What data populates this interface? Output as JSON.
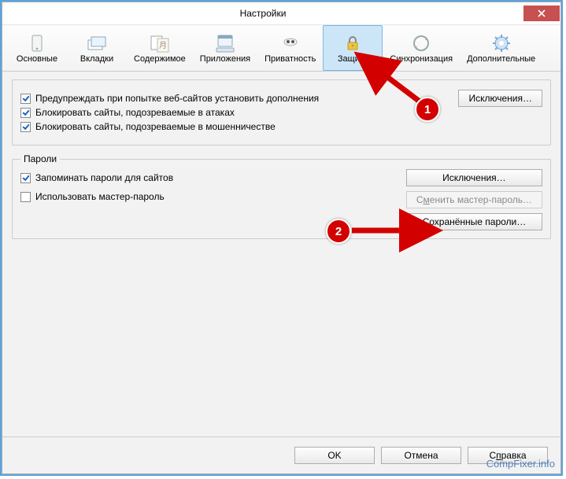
{
  "window": {
    "title": "Настройки"
  },
  "tabs": [
    {
      "label": "Основные"
    },
    {
      "label": "Вкладки"
    },
    {
      "label": "Содержимое"
    },
    {
      "label": "Приложения"
    },
    {
      "label": "Приватность"
    },
    {
      "label": "Защита"
    },
    {
      "label": "Синхронизация"
    },
    {
      "label": "Дополнительные"
    }
  ],
  "topGroup": {
    "warn_addons": "Предупреждать при попытке веб-сайтов установить дополнения",
    "block_attack": "Блокировать сайты, подозреваемые в атаках",
    "block_fraud": "Блокировать сайты, подозреваемые в мошенничестве",
    "exceptions": "Исключения…"
  },
  "passwords": {
    "legend": "Пароли",
    "remember": "Запоминать пароли для сайтов",
    "use_master": "Использовать мастер-пароль",
    "exceptions": "Исключения…",
    "change_master_pre": "С",
    "change_master_und": "м",
    "change_master_post": "енить мастер-пароль…",
    "saved": "Сохранённые пароли…"
  },
  "footer": {
    "ok": "OK",
    "cancel": "Отмена",
    "help_pre": "С",
    "help_und": "п",
    "help_post": "равка"
  },
  "annotations": {
    "one": "1",
    "two": "2"
  },
  "watermark": "CompFixer.info"
}
